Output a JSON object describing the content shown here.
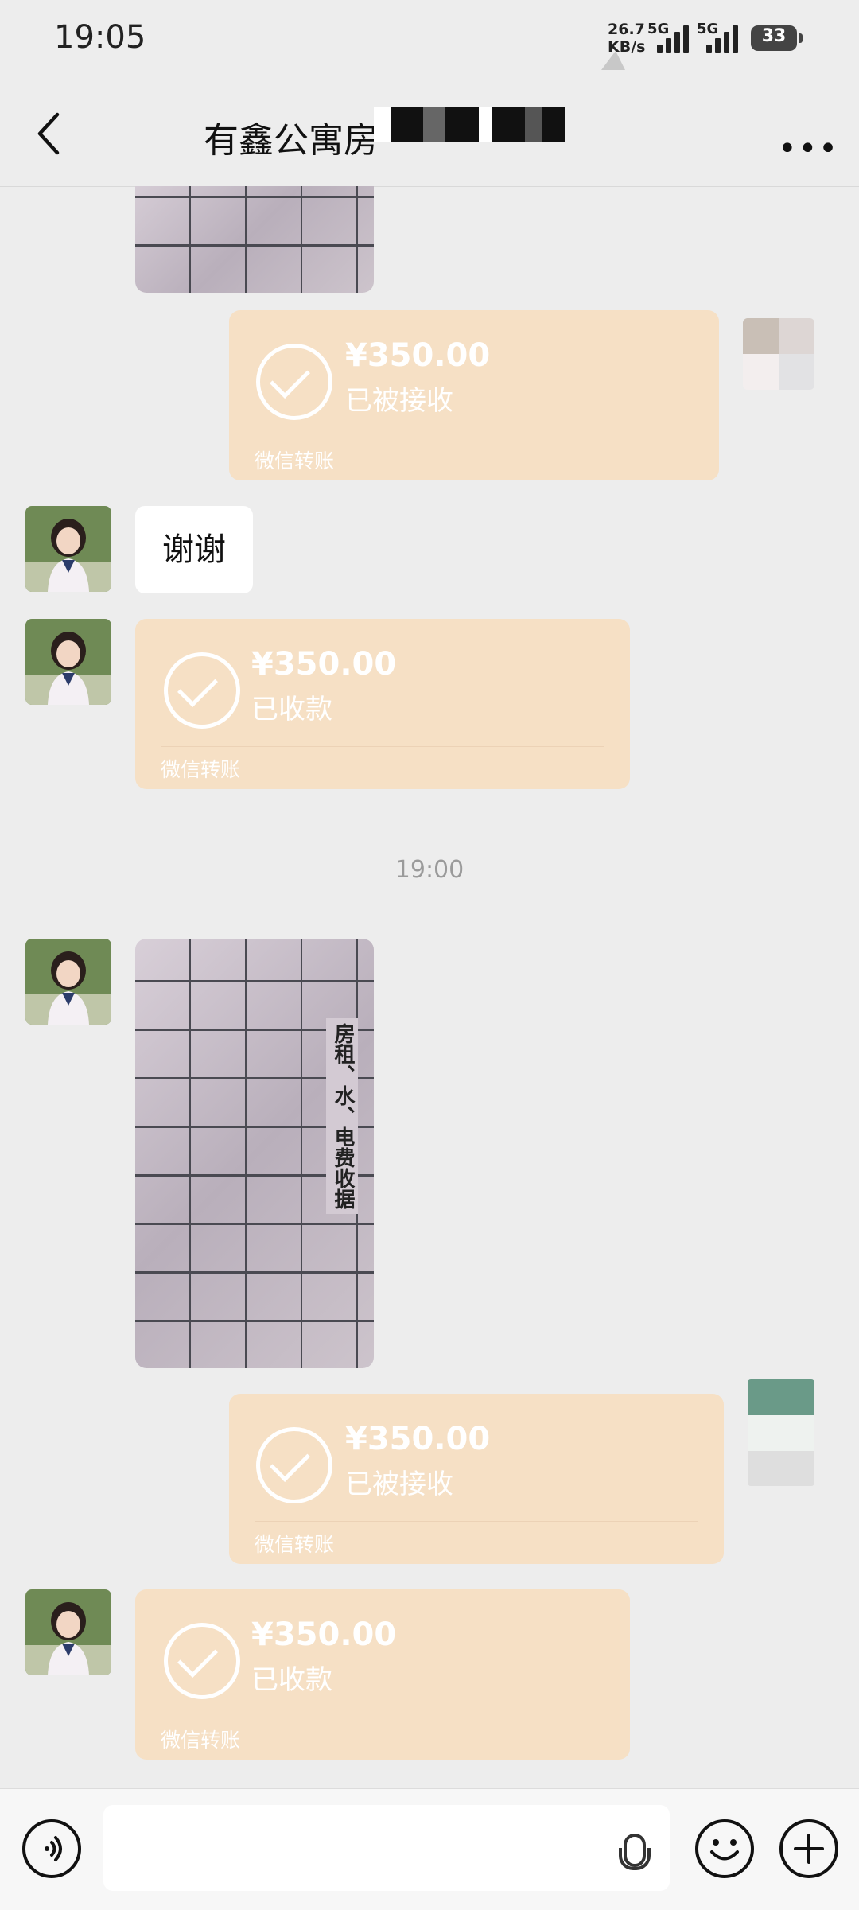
{
  "status_bar": {
    "time": "19:05",
    "net_speed": "26.7",
    "net_unit": "KB/s",
    "sim1": "5G",
    "sim2": "5G",
    "battery": "33"
  },
  "header": {
    "title": "有鑫公寓房",
    "back_icon": "chevron-left-icon",
    "more_icon": "more-icon"
  },
  "messages": [
    {
      "type": "image",
      "side": "left",
      "content": "receipt-photo"
    },
    {
      "type": "transfer",
      "side": "right",
      "amount": "¥350.00",
      "status": "已被接收",
      "label": "微信转账"
    },
    {
      "type": "text",
      "side": "left",
      "text": "谢谢"
    },
    {
      "type": "transfer",
      "side": "left",
      "amount": "¥350.00",
      "status": "已收款",
      "label": "微信转账"
    },
    {
      "type": "time",
      "text": "19:00"
    },
    {
      "type": "image",
      "side": "left",
      "content": "receipt-photo",
      "receipt_heading": "房租、水、电费收据"
    },
    {
      "type": "transfer",
      "side": "right",
      "amount": "¥350.00",
      "status": "已被接收",
      "label": "微信转账"
    },
    {
      "type": "transfer",
      "side": "left",
      "amount": "¥350.00",
      "status": "已收款",
      "label": "微信转账"
    }
  ],
  "input_bar": {
    "voice_icon": "voice-icon",
    "mic_icon": "microphone-icon",
    "emoji_icon": "emoji-icon",
    "plus_icon": "plus-icon"
  },
  "colors": {
    "background": "#ededed",
    "transfer_bubble": "#f6e0c5",
    "text_bubble": "#ffffff"
  }
}
